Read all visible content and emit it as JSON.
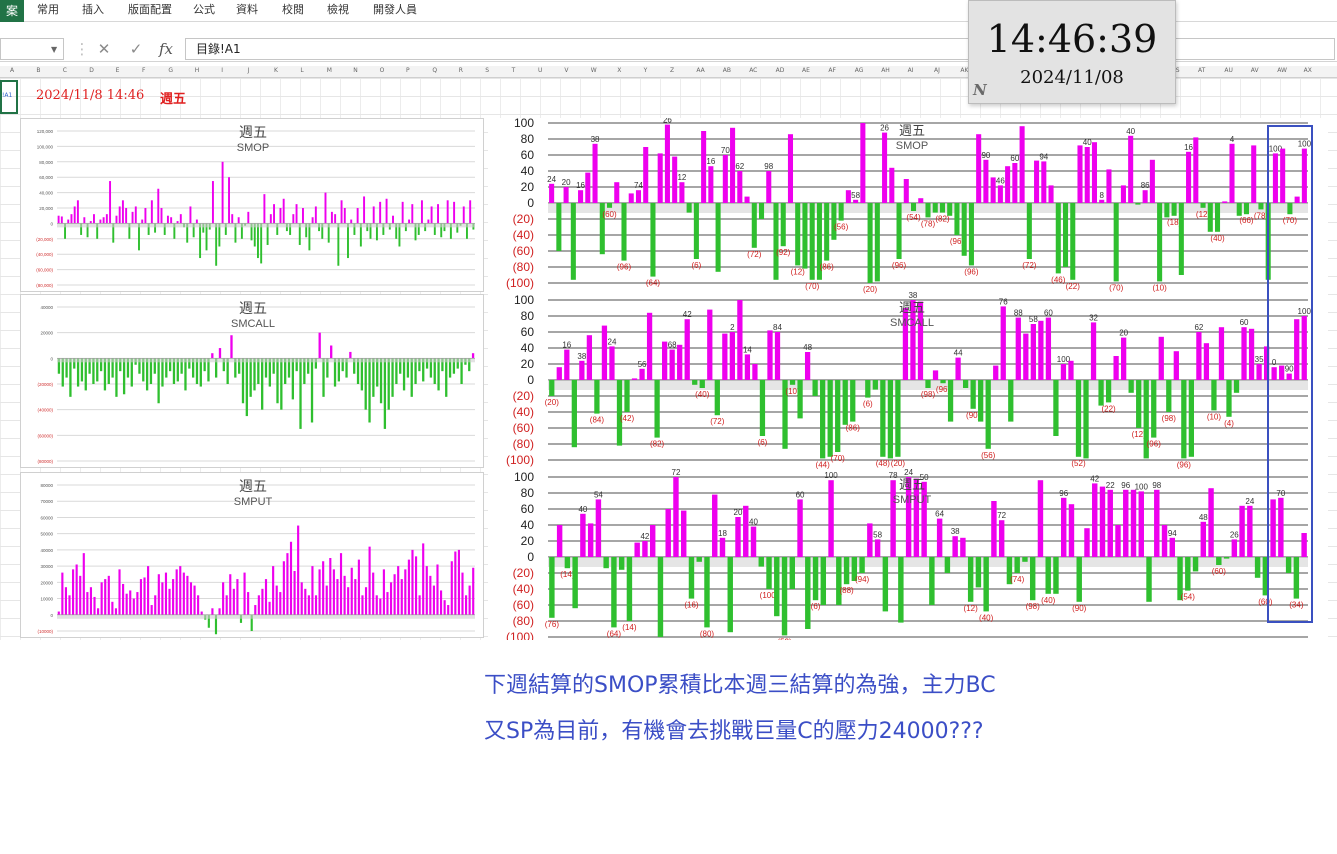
{
  "ribbon": {
    "file_tab": "案",
    "tabs": [
      "常用",
      "插入",
      "版面配置",
      "公式",
      "資料",
      "校閱",
      "檢視",
      "開發人員"
    ]
  },
  "formula_bar": {
    "name_box": "",
    "cancel_icon": "close-icon",
    "enter_icon": "check-icon",
    "fx_label": "fx",
    "formula": "目錄!A1"
  },
  "columns": [
    "A",
    "B",
    "C",
    "D",
    "E",
    "F",
    "G",
    "H",
    "I",
    "J",
    "K",
    "L",
    "M",
    "N",
    "O",
    "P",
    "Q",
    "R",
    "S",
    "T",
    "U",
    "V",
    "W",
    "X",
    "Y",
    "Z",
    "AA",
    "AB",
    "AC",
    "AD",
    "AE",
    "AF",
    "AG",
    "AH",
    "AI",
    "AJ",
    "AK",
    "AL",
    "AM",
    "AN",
    "AO",
    "AP",
    "AQ",
    "AR",
    "AS",
    "AT",
    "AU",
    "AV",
    "AW",
    "AX"
  ],
  "sheet": {
    "cell_a1": "!A1",
    "date": "2024/11/8 14:46",
    "weekday": "週五"
  },
  "clock": {
    "time": "14:46:39",
    "date": "2024/11/08",
    "logo": "N"
  },
  "colors": {
    "positive": "#ee00ee",
    "negative": "#2fbf2f",
    "highlight": "#3a50c0",
    "caption": "#3b4ec6",
    "red_text": "#e02020"
  },
  "chart_data": [
    {
      "type": "bar",
      "panel": "left-top",
      "title": "週五",
      "subtitle": "SMOP",
      "yticks": [
        "120,000",
        "100,000",
        "80,000",
        "60,000",
        "40,000",
        "20,000",
        "0",
        "(20,000)",
        "(40,000)",
        "(60,000)",
        "(80,000)"
      ],
      "ylim": [
        -80000,
        120000
      ],
      "values": [
        10000,
        9000,
        -20000,
        5000,
        12000,
        22000,
        30000,
        -15000,
        8000,
        -18000,
        3000,
        12000,
        -20000,
        5000,
        8000,
        12000,
        55000,
        -25000,
        10000,
        22000,
        30000,
        20000,
        -20000,
        15000,
        22000,
        -35000,
        5000,
        20000,
        -15000,
        30000,
        -12000,
        45000,
        20000,
        -15000,
        10000,
        8000,
        -20000,
        3000,
        12000,
        -5000,
        -25000,
        22000,
        -18000,
        5000,
        -45000,
        -12000,
        -35000,
        -8000,
        55000,
        -55000,
        -30000,
        80000,
        -15000,
        60000,
        12000,
        -25000,
        8000,
        -20000,
        -3000,
        15000,
        -22000,
        -30000,
        -45000,
        -52000,
        38000,
        -28000,
        12000,
        25000,
        -15000,
        20000,
        32000,
        -10000,
        -15000,
        12000,
        25000,
        -28000,
        20000,
        -18000,
        -35000,
        8000,
        22000,
        -10000,
        -20000,
        40000,
        -25000,
        15000,
        12000,
        -55000,
        30000,
        20000,
        -45000,
        5000,
        -15000,
        20000,
        -30000,
        35000,
        -10000,
        -20000,
        22000,
        -22000,
        28000,
        -15000,
        32000,
        -8000,
        10000,
        -20000,
        -30000,
        28000,
        -10000,
        5000,
        25000,
        -22000,
        -15000,
        30000,
        -10000,
        5000,
        22000,
        -15000,
        25000,
        -18000,
        -10000,
        30000,
        -20000,
        28000,
        -12000,
        -3000,
        22000,
        -20000,
        30000,
        -8000
      ],
      "xlabel": "",
      "ylabel": ""
    },
    {
      "type": "bar",
      "panel": "left-middle",
      "title": "週五",
      "subtitle": "SMCALL",
      "yticks": [
        "40000",
        "20000",
        "0",
        "(20000)",
        "(40000)",
        "(60000)",
        "(80000)"
      ],
      "ylim": [
        -80000,
        40000
      ],
      "values": [
        -12000,
        -22000,
        -15000,
        -30000,
        -8000,
        -22000,
        -18000,
        -25000,
        -12000,
        -20000,
        -18000,
        -10000,
        -25000,
        -20000,
        -15000,
        -30000,
        -10000,
        -28000,
        -15000,
        -22000,
        -5000,
        -12000,
        -18000,
        -25000,
        -20000,
        -12000,
        -35000,
        -22000,
        -15000,
        -10000,
        -20000,
        -18000,
        -12000,
        -25000,
        -8000,
        -15000,
        -20000,
        -22000,
        -10000,
        -18000,
        4000,
        -15000,
        8000,
        -10000,
        -20000,
        18000,
        -15000,
        -12000,
        -35000,
        -45000,
        -30000,
        -25000,
        -20000,
        -40000,
        -15000,
        -22000,
        -12000,
        -35000,
        -40000,
        -20000,
        -15000,
        -32000,
        -10000,
        -55000,
        -20000,
        -12000,
        -50000,
        -8000,
        20000,
        -30000,
        -15000,
        10000,
        -22000,
        -18000,
        -10000,
        -15000,
        5000,
        -12000,
        -20000,
        -25000,
        -40000,
        -50000,
        -30000,
        -22000,
        -35000,
        -55000,
        -40000,
        -30000,
        -20000,
        -12000,
        -25000,
        -15000,
        -30000,
        -20000,
        -10000,
        -18000,
        -8000,
        -15000,
        -20000,
        -25000,
        -10000,
        -30000,
        -15000,
        -12000,
        -8000,
        -20000,
        -5000,
        -10000,
        4000
      ],
      "xlabel": "",
      "ylabel": ""
    },
    {
      "type": "bar",
      "panel": "left-bottom",
      "title": "週五",
      "subtitle": "SMPUT",
      "yticks": [
        "80000",
        "70000",
        "60000",
        "50000",
        "40000",
        "30000",
        "20000",
        "10000",
        "0",
        "(10000)"
      ],
      "ylim": [
        -10000,
        80000
      ],
      "values": [
        2000,
        26000,
        17000,
        12000,
        28000,
        31000,
        24000,
        38000,
        14000,
        17000,
        11000,
        4000,
        20000,
        22000,
        24000,
        8000,
        4000,
        28000,
        19000,
        13000,
        15000,
        10000,
        14000,
        22000,
        23000,
        30000,
        6000,
        12000,
        25000,
        20000,
        26000,
        16000,
        22000,
        28000,
        30000,
        26000,
        24000,
        20000,
        18000,
        12000,
        2000,
        -3000,
        -8000,
        4000,
        -12000,
        4000,
        20000,
        12000,
        25000,
        16000,
        22000,
        -5000,
        26000,
        14000,
        -10000,
        6000,
        12000,
        16000,
        22000,
        8000,
        30000,
        18000,
        14000,
        33000,
        38000,
        45000,
        27000,
        55000,
        20000,
        16000,
        12000,
        30000,
        12000,
        28000,
        33000,
        18000,
        35000,
        28000,
        22000,
        38000,
        24000,
        17000,
        29000,
        22000,
        34000,
        12000,
        17000,
        42000,
        26000,
        12000,
        10000,
        28000,
        14000,
        20000,
        25000,
        30000,
        22000,
        28000,
        34000,
        40000,
        36000,
        12000,
        44000,
        30000,
        24000,
        18000,
        31000,
        15000,
        9000,
        6000,
        33000,
        39000,
        40000,
        26000,
        12000,
        18000,
        29000
      ],
      "xlabel": "",
      "ylabel": ""
    },
    {
      "type": "bar",
      "panel": "right-top",
      "title": "週五",
      "subtitle": "SMOP",
      "yticks": [
        "100",
        "80",
        "60",
        "40",
        "20",
        "0",
        "(20)",
        "(40)",
        "(60)",
        "(80)",
        "(100)"
      ],
      "ylim": [
        -100,
        100
      ],
      "values": [
        24,
        -60,
        20,
        -96,
        16,
        38,
        74,
        -64,
        -6,
        26,
        -72,
        12,
        16,
        70,
        -92,
        62,
        98,
        58,
        26,
        -12,
        -70,
        90,
        46,
        -86,
        60,
        94,
        40,
        8,
        -56,
        -20,
        40,
        -96,
        -54,
        86,
        -78,
        -82,
        -96,
        -96,
        -72,
        -46,
        -22,
        16,
        4,
        100,
        -100,
        -98,
        88,
        44,
        -70,
        30,
        -10,
        6,
        -18,
        -12,
        -12,
        -16,
        -40,
        -66,
        -78,
        86,
        54,
        32,
        22,
        46,
        50,
        96,
        -70,
        53,
        52,
        22,
        -88,
        -80,
        -96,
        72,
        70,
        76,
        4,
        42,
        -98,
        22,
        84,
        -2,
        16,
        54,
        -98,
        -18,
        -16,
        -90,
        64,
        82,
        -6,
        -36,
        -36,
        2,
        74,
        -16,
        -14,
        72,
        -8,
        -96,
        62,
        68,
        -14,
        8,
        68
      ],
      "labels_positive": [
        "24",
        "20",
        "16",
        "38",
        "74",
        "26",
        "12",
        "16",
        "70",
        "62",
        "98",
        "58",
        "26",
        "90",
        "46",
        "60",
        "94",
        "40",
        "8",
        "40",
        "86",
        "16",
        "4",
        "100",
        "100",
        "98",
        "88",
        "44",
        "30",
        "6",
        "86",
        "54",
        "32",
        "22",
        "46",
        "50",
        "96",
        "53",
        "52",
        "22",
        "72",
        "70",
        "76",
        "4",
        "42",
        "22",
        "84",
        "2",
        "16",
        "54",
        "64",
        "82",
        "2",
        "74",
        "72",
        "62",
        "68",
        "8",
        "68"
      ],
      "labels_negative": [
        "(60)",
        "(96)",
        "(64)",
        "(6)",
        "(72)",
        "(92)",
        "(12)",
        "(70)",
        "(86)",
        "(56)",
        "(20)",
        "(96)",
        "(54)",
        "(78)",
        "(82)",
        "(96)",
        "(96)",
        "(72)",
        "(46)",
        "(22)",
        "(70)",
        "(10)",
        "(18)",
        "(12)",
        "(40)",
        "(66)",
        "(78)",
        "(70)",
        "(88)",
        "(80)",
        "(96)",
        "(98)",
        "(18)",
        "(16)",
        "(98)",
        "(90)",
        "(36)",
        "(36)",
        "(16)",
        "(14)"
      ]
    },
    {
      "type": "bar",
      "panel": "right-middle",
      "title": "週五",
      "subtitle": "SMCALL",
      "yticks": [
        "100",
        "80",
        "60",
        "40",
        "20",
        "0",
        "(20)",
        "(40)",
        "(60)",
        "(80)",
        "(100)"
      ],
      "ylim": [
        -100,
        100
      ],
      "values": [
        -20,
        16,
        38,
        -84,
        24,
        56,
        -42,
        68,
        42,
        -82,
        -40,
        2,
        14,
        84,
        -72,
        48,
        38,
        44,
        76,
        -6,
        -10,
        88,
        -44,
        58,
        60,
        100,
        32,
        20,
        -70,
        62,
        60,
        -86,
        -6,
        -48,
        35,
        -20,
        -98,
        -96,
        -90,
        -56,
        -52,
        0,
        -22,
        -12,
        -96,
        -98,
        -96,
        90,
        100,
        98,
        -10,
        12,
        -4,
        -52,
        28,
        -10,
        -36,
        -52,
        -86,
        18,
        92,
        -52,
        78,
        58,
        70,
        74,
        78,
        -70,
        20,
        24,
        -96,
        -98,
        72,
        -32,
        -28,
        30,
        53,
        -16,
        -60,
        -98,
        -72,
        54,
        -40,
        36,
        -98,
        -96,
        60,
        46,
        -38,
        66,
        -46,
        -16,
        66,
        64,
        20,
        42,
        16,
        18,
        8,
        76,
        80
      ],
      "labels_positive": [
        "16",
        "38",
        "24",
        "56",
        "68",
        "42",
        "2",
        "14",
        "84",
        "48",
        "38",
        "44",
        "76",
        "88",
        "58",
        "60",
        "100",
        "32",
        "20",
        "62",
        "60",
        "35",
        "0",
        "90",
        "100",
        "98",
        "12",
        "28",
        "18",
        "92",
        "52",
        "78",
        "58",
        "70",
        "74",
        "78",
        "20",
        "24",
        "72",
        "30",
        "53",
        "54",
        "36",
        "60",
        "46",
        "66",
        "66",
        "64",
        "20",
        "42",
        "16",
        "18",
        "8",
        "76",
        "80"
      ],
      "labels_negative": [
        "(20)",
        "(84)",
        "(42)",
        "(82)",
        "(40)",
        "(72)",
        "(6)",
        "(10)",
        "(44)",
        "(70)",
        "(86)",
        "(6)",
        "(48)",
        "(20)",
        "(98)",
        "(96)",
        "(90)",
        "(56)",
        "(52)",
        "(22)",
        "(12)",
        "(96)",
        "(98)",
        "(96)",
        "(10)",
        "(4)",
        "(52)",
        "(10)",
        "(36)",
        "(52)",
        "(86)",
        "(70)",
        "(96)",
        "(98)",
        "(32)",
        "(28)",
        "(16)",
        "(60)",
        "(98)",
        "(72)",
        "(40)",
        "(98)",
        "(96)",
        "(38)",
        "(46)",
        "(16)"
      ]
    },
    {
      "type": "bar",
      "panel": "right-bottom",
      "title": "週五",
      "subtitle": "SMPUT",
      "yticks": [
        "100",
        "80",
        "60",
        "40",
        "20",
        "0",
        "(20)",
        "(40)",
        "(60)",
        "(80)",
        "(100)"
      ],
      "ylim": [
        -100,
        100
      ],
      "values": [
        -76,
        40,
        -14,
        -64,
        54,
        42,
        72,
        -14,
        -88,
        -16,
        -80,
        18,
        20,
        40,
        -100,
        60,
        100,
        58,
        -52,
        -6,
        -88,
        78,
        24,
        -94,
        50,
        64,
        38,
        -12,
        -40,
        -74,
        -98,
        -40,
        72,
        -90,
        -54,
        -60,
        96,
        -60,
        -34,
        -30,
        -20,
        42,
        22,
        -68,
        96,
        -82,
        100,
        98,
        94,
        -60,
        48,
        -20,
        26,
        24,
        -56,
        -38,
        -68,
        70,
        46,
        -34,
        -20,
        -6,
        -54,
        96,
        -46,
        -46,
        74,
        66,
        -56,
        36,
        92,
        88,
        84,
        40,
        84,
        84,
        82,
        -56,
        84,
        40,
        24,
        -54,
        -42,
        -18,
        44,
        86,
        -10,
        -2,
        22,
        64,
        64,
        -26,
        -48,
        72,
        74,
        -20,
        -52,
        30
      ],
      "labels_positive": [
        "40",
        "54",
        "42",
        "72",
        "18",
        "20",
        "40",
        "60",
        "100",
        "58",
        "78",
        "24",
        "50",
        "64",
        "38",
        "72",
        "96",
        "42",
        "22",
        "96",
        "100",
        "98",
        "94",
        "48",
        "26",
        "24",
        "70",
        "46",
        "96",
        "74",
        "66",
        "36",
        "92",
        "88",
        "84",
        "40",
        "84",
        "84",
        "82",
        "84",
        "40",
        "24",
        "44",
        "86",
        "22",
        "64",
        "64",
        "72",
        "74",
        "30"
      ],
      "labels_negative": [
        "(76)",
        "(14)",
        "(64)",
        "(14)",
        "(88)",
        "(16)",
        "(80)",
        "(100)",
        "(52)",
        "(6)",
        "(88)",
        "(94)",
        "(12)",
        "(40)",
        "(74)",
        "(98)",
        "(40)",
        "(90)",
        "(54)",
        "(60)",
        "(60)",
        "(34)",
        "(30)",
        "(68)",
        "(82)",
        "(60)",
        "(20)",
        "(56)",
        "(38)",
        "(68)",
        "(34)",
        "(20)",
        "(6)",
        "(54)",
        "(46)",
        "(46)",
        "(56)",
        "(54)",
        "(42)",
        "(18)",
        "(10)",
        "(2)",
        "(26)",
        "(48)",
        "(20)",
        "(52)"
      ]
    }
  ],
  "caption": {
    "line1": "下週結算的SMOP累積比本週三結算的為強，主力BC",
    "line2": "又SP為目前，有機會去挑戰巨量C的壓力24000???"
  }
}
